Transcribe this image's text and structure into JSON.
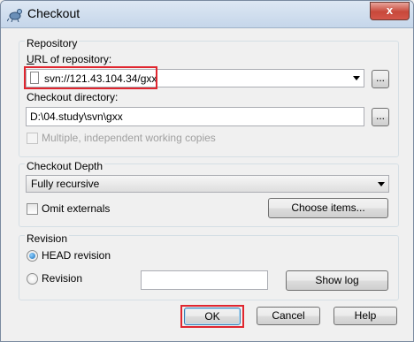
{
  "window": {
    "title": "Checkout",
    "close_glyph": "x"
  },
  "repository": {
    "group_label": "Repository",
    "url_label": "URL of repository:",
    "url_value": "svn://121.43.104.34/gxx",
    "browse_label": "...",
    "dir_label": "Checkout directory:",
    "dir_value": "D:\\04.study\\svn\\gxx",
    "dir_browse_label": "...",
    "multi_label": "Multiple, independent working copies"
  },
  "depth": {
    "group_label": "Checkout Depth",
    "selected": "Fully recursive",
    "omit_label": "Omit externals",
    "choose_label": "Choose items..."
  },
  "revision": {
    "group_label": "Revision",
    "head_label": "HEAD revision",
    "rev_label": "Revision",
    "rev_value": "",
    "show_log_label": "Show log",
    "head_selected": true
  },
  "buttons": {
    "ok": "OK",
    "cancel": "Cancel",
    "help": "Help"
  },
  "colors": {
    "highlight": "#e0262f",
    "close": "#c7483a"
  }
}
